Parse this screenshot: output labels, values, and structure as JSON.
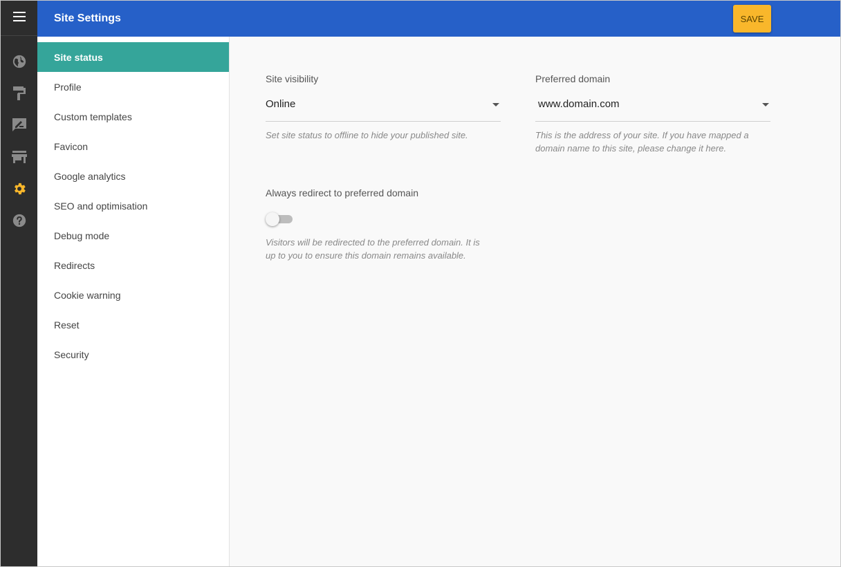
{
  "header": {
    "title": "Site Settings",
    "save_label": "SAVE"
  },
  "rail": {
    "menu_icon": "hamburger-icon",
    "items": [
      {
        "icon": "globe-icon",
        "active": false
      },
      {
        "icon": "paint-roller-icon",
        "active": false
      },
      {
        "icon": "edit-post-icon",
        "active": false
      },
      {
        "icon": "store-icon",
        "active": false
      },
      {
        "icon": "gear-icon",
        "active": true
      },
      {
        "icon": "help-icon",
        "active": false
      }
    ],
    "active_color": "#f9b72b",
    "icon_color": "#8a8a8a"
  },
  "sidebar": {
    "items": [
      {
        "label": "Site status",
        "active": true
      },
      {
        "label": "Profile"
      },
      {
        "label": "Custom templates"
      },
      {
        "label": "Favicon"
      },
      {
        "label": "Google analytics"
      },
      {
        "label": "SEO and optimisation"
      },
      {
        "label": "Debug mode"
      },
      {
        "label": "Redirects"
      },
      {
        "label": "Cookie warning"
      },
      {
        "label": "Reset"
      },
      {
        "label": "Security"
      }
    ],
    "active_color": "#35a59a"
  },
  "main": {
    "visibility": {
      "label": "Site visibility",
      "value": "Online",
      "hint": "Set site status to offline to hide your published site."
    },
    "domain": {
      "label": "Preferred domain",
      "value": "www.domain.com",
      "hint_line1": "This is the address of your site. If you have mapped a",
      "hint_line2": "domain name to this site, please change it here."
    },
    "redirect": {
      "label": "Always redirect to preferred domain",
      "enabled": false,
      "hint_line1": "Visitors will be redirected to the preferred domain. It is",
      "hint_line2": "up to you to ensure this domain remains available."
    }
  },
  "colors": {
    "header": "#2660c8",
    "rail": "#2d2d2d",
    "save": "#f9b72b"
  }
}
